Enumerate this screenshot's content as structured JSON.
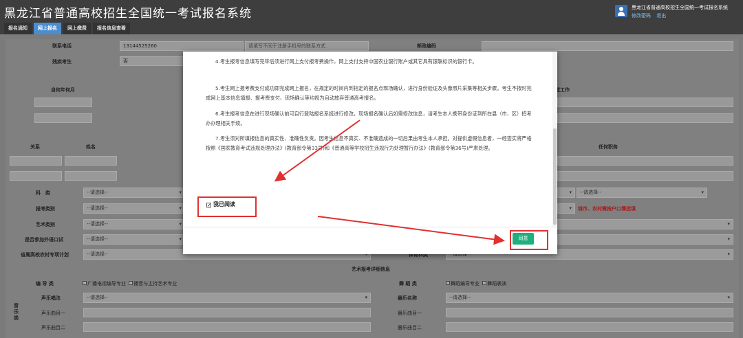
{
  "header": {
    "title": "黑龙江省普通高校招生全国统一考试报名系统",
    "user_system": "黑龙江省普通高校招生全国统一考试报名系统",
    "change_password": "修改密码",
    "logout": "退出"
  },
  "tabs": [
    {
      "label": "报名通知"
    },
    {
      "label": "网上报名"
    },
    {
      "label": "网上缴费"
    },
    {
      "label": "报名信息查看"
    }
  ],
  "form": {
    "phone_label": "联系电话",
    "phone_value": "13144525260",
    "contact_placeholder": "请填写不同于注册手机号的联系方式",
    "postcode_label": "邮政编码",
    "disabled_label": "残疾考生",
    "disabled_value": "否",
    "from_label": "自何年何月",
    "study_work_label": "学习或工作",
    "relation_label": "关系",
    "name_label": "姓名",
    "position_label": "任何职务",
    "subject_label": "科　类",
    "exam_type_label": "报考类别",
    "art_type_label": "艺术类别",
    "foreign_lang_label": "是否参加外语口试",
    "rural_plan_label": "省属高校农村专项计划",
    "sports_label": "体育科类",
    "placeholder_select": "--请选择--",
    "rural_note": "城市、农村需按户口簿选填",
    "art_detail_title": "艺术报考详细信息",
    "director_label": "编 导 类",
    "director_opt1": "广播电视编导专业",
    "director_opt2": "播音与主持艺术专业",
    "dance_label": "舞 蹈 类",
    "dance_opt1": "舞蹈编导专业",
    "dance_opt2": "舞蹈表演",
    "music_group_label": "音乐类",
    "vocal_label": "声乐唱法",
    "instrument_label": "器乐名称",
    "vocal_song1": "声乐曲目一",
    "vocal_song2": "声乐曲目二",
    "instr_song1": "器乐曲目一",
    "instr_song2": "器乐曲目二"
  },
  "modal": {
    "items": [
      "4.考生报考信息填写完毕后须进行网上支付报考费操作，网上支付支持中国农业银行账户或其它具有银联标识的银行卡。",
      "5.考生网上报考费支付成功即完成网上报名，在规定的时间内到指定的报名点现场确认，进行身份验证及头像照片采集等相关步骤。考生不按时完成网上基本信息填报、报考费支付、现场确认等均视为自动放弃普通高考报名。",
      "6.考生报考信息在进行现场确认前可自行登陆报名系统进行修改，现场报名确认后如需修改信息，请考生本人携带身份证到所在县（市、区）招考办办理相关手续。",
      "7.考生须对所填报信息的真实性、准确性负责。因考生信息不真实、不准确造成的一切后果由考生本人承担。对提供虚假信息者，一经查实将严格按照《国家教育考试违规处理办法》(教育部令第33号)和《普通高等学校招生违规行为处理暂行办法》(教育部令第36号)严肃处理。"
    ],
    "read_label": "我已阅读",
    "agree_button": "同意"
  },
  "colors": {
    "accent_tab": "#4a8ed0",
    "agree_button": "#1fae7e",
    "highlight": "#e03030"
  }
}
